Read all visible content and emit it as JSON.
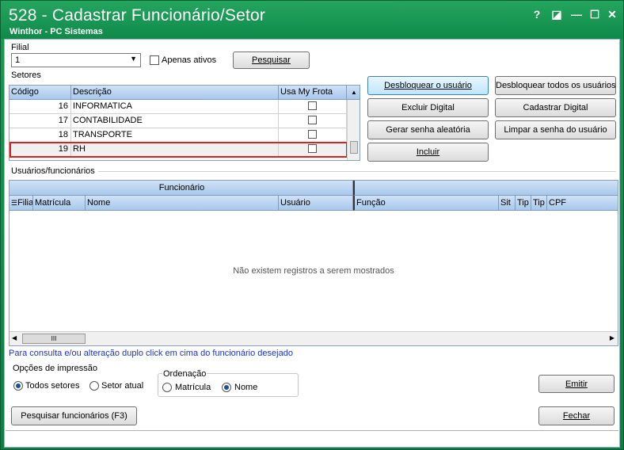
{
  "window": {
    "title": "528 - Cadastrar Funcionário/Setor",
    "subtitle": "Winthor - PC Sistemas",
    "controls": [
      "?",
      "◪",
      "—",
      "☐",
      "✕"
    ]
  },
  "filial": {
    "label": "Filial",
    "value": "1",
    "apenas_ativos_label": "Apenas ativos",
    "search_button": "Pesquisar"
  },
  "setores": {
    "label": "Setores",
    "columns": [
      "Código",
      "Descrição",
      "Usa My Frota"
    ],
    "rows": [
      {
        "codigo": "16",
        "descricao": "INFORMATICA"
      },
      {
        "codigo": "17",
        "descricao": "CONTABILIDADE"
      },
      {
        "codigo": "18",
        "descricao": "TRANSPORTE"
      },
      {
        "codigo": "19",
        "descricao": "RH"
      }
    ]
  },
  "actions": {
    "desbloquear_usuario": "Desbloquear o usuário",
    "desbloquear_todos": "Desbloquear todos os usuários",
    "excluir_digital": "Excluir Digital",
    "cadastrar_digital": "Cadastrar Digital",
    "gerar_senha": "Gerar senha aleatória",
    "limpar_senha": "Limpar a senha do usuário",
    "incluir": "Incluir"
  },
  "usuarios": {
    "label": "Usuários/funcionários",
    "group_header": "Funcionário",
    "columns": [
      "Filia",
      "Matrícula",
      "Nome",
      "Usuário",
      "Função",
      "Sit",
      "Tip",
      "Tip",
      "CPF"
    ],
    "empty_message": "Não existem registros a serem mostrados",
    "scroll_thumb": "III"
  },
  "hint": "Para consulta e/ou alteração duplo click em cima do funcionário desejado",
  "impressao": {
    "label": "Opções de impressão",
    "todos_setores": "Todos setores",
    "setor_atual": "Setor atual"
  },
  "ordenacao": {
    "label": "Ordenação",
    "matricula": "Matrícula",
    "nome": "Nome"
  },
  "footer": {
    "emitir": "Emitir",
    "pesquisar_funcionarios": "Pesquisar funcionários (F3)",
    "fechar": "Fechar"
  },
  "colors": {
    "title_green": "#0f8a49",
    "selection_red": "#e0201c",
    "hint_blue": "#1a33c8",
    "grid_header": "#b7d1ef"
  }
}
